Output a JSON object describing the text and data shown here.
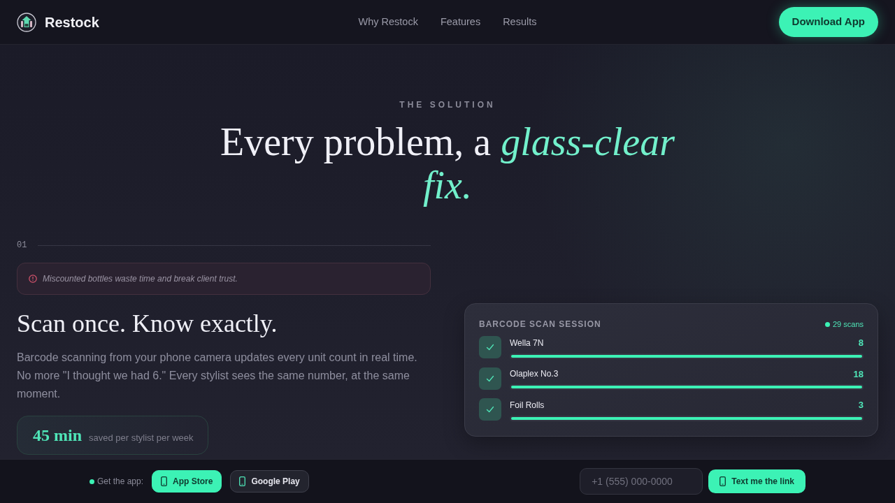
{
  "nav": {
    "brand": "Restock",
    "links": [
      "Why Restock",
      "Features",
      "Results"
    ],
    "cta": "Download App"
  },
  "hero": {
    "eyebrow": "THE SOLUTION",
    "heading": "Every problem, a *glass-clear fix.*"
  },
  "solution": {
    "number": "01",
    "problem": "Miscounted bottles waste time and break client trust.",
    "title": "Scan once. Know exactly.",
    "body": "Barcode scanning from your phone camera updates every unit count in real time. No more \"I thought we had 6.\" Every stylist sees the same number, at the same moment.",
    "stat": {
      "value": "45 min",
      "label": "saved per stylist per week"
    }
  },
  "scan_card": {
    "title": "BARCODE SCAN SESSION",
    "count": "29 scans",
    "items": [
      {
        "name": "Wella 7N",
        "count": "8",
        "checked": true,
        "level": 1
      },
      {
        "name": "Olaplex No.3",
        "count": "18",
        "checked": true,
        "level": 1
      },
      {
        "name": "Foil Rolls",
        "count": "3",
        "checked": true,
        "level": 1
      }
    ]
  },
  "app_bar": {
    "prompt": "Get the app:",
    "stores": [
      {
        "label": "App Store",
        "kind": "primary"
      },
      {
        "label": "Google Play",
        "kind": "secondary"
      }
    ],
    "phone": {
      "placeholder": "+1 (555) 000-0000"
    },
    "send": "Text me the link"
  }
}
